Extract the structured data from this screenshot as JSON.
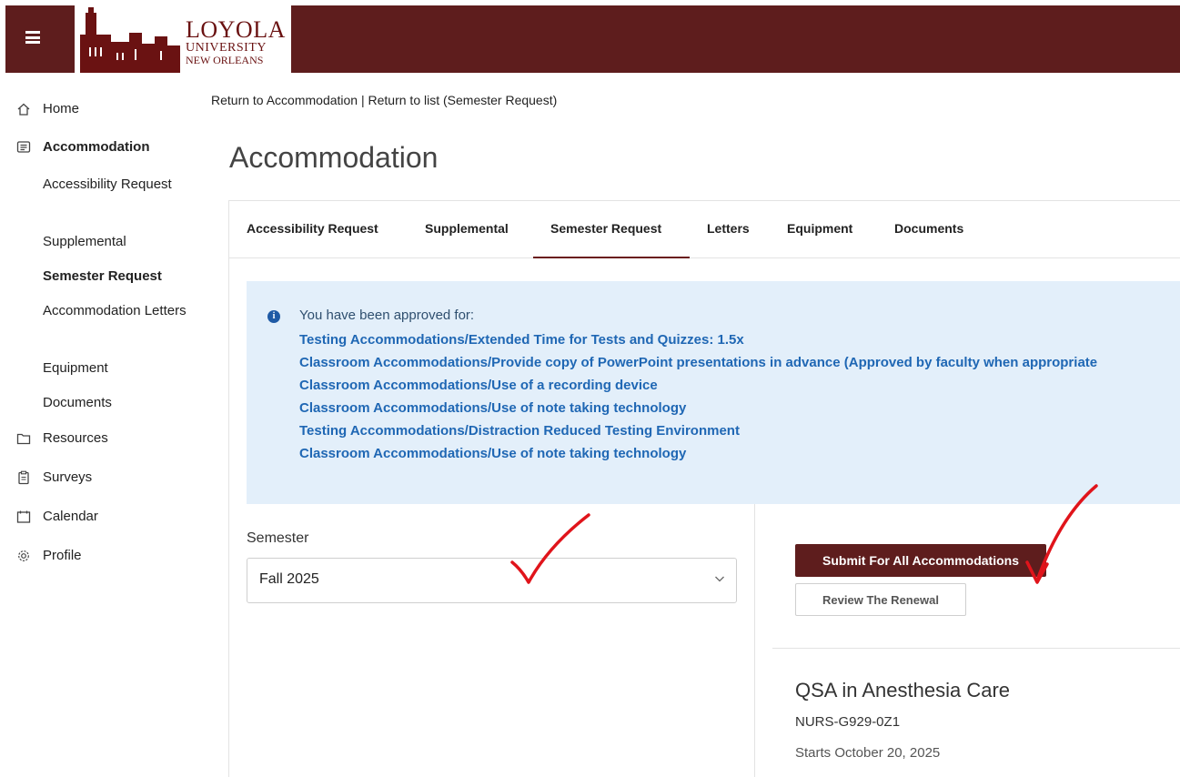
{
  "header": {
    "logo": {
      "line1": "LOYOLA",
      "line2": "UNIVERSITY",
      "line3": "NEW ORLEANS"
    },
    "colors": {
      "brand": "#5e1d1d",
      "link": "#1f67b4",
      "alert_bg": "#e3effa"
    }
  },
  "sidebar": {
    "items": [
      {
        "label": "Home",
        "icon": "home-icon"
      },
      {
        "label": "Accommodation",
        "icon": "chat-list-icon"
      },
      {
        "label": "Resources",
        "icon": "folder-icon"
      },
      {
        "label": "Surveys",
        "icon": "clipboard-icon"
      },
      {
        "label": "Calendar",
        "icon": "calendar-icon"
      },
      {
        "label": "Profile",
        "icon": "gear-icon"
      }
    ],
    "sub_items": [
      {
        "label": "Accessibility Request"
      },
      {
        "label": "Supplemental"
      },
      {
        "label": "Semester Request"
      },
      {
        "label": "Accommodation Letters"
      },
      {
        "label": "Equipment"
      },
      {
        "label": "Documents"
      }
    ]
  },
  "breadcrumb": {
    "link1": "Return to Accommodation",
    "separator": " | ",
    "link2": "Return to list (Semester Request)"
  },
  "page": {
    "title": "Accommodation"
  },
  "tabs": [
    {
      "label": "Accessibility Request"
    },
    {
      "label": "Supplemental"
    },
    {
      "label": "Semester Request"
    },
    {
      "label": "Letters"
    },
    {
      "label": "Equipment"
    },
    {
      "label": "Documents"
    }
  ],
  "alert": {
    "title": "You have been approved for:",
    "lines": [
      "Testing Accommodations/Extended Time for Tests and Quizzes: 1.5x",
      "Classroom Accommodations/Provide copy of PowerPoint presentations in advance (Approved by faculty when appropriate",
      "Classroom Accommodations/Use of a recording device",
      "Classroom Accommodations/Use of note taking technology",
      "Testing Accommodations/Distraction Reduced Testing Environment",
      "Classroom Accommodations/Use of note taking technology"
    ]
  },
  "semester": {
    "label": "Semester",
    "value": "Fall 2025"
  },
  "actions": {
    "submit_all": "Submit For All Accommodations",
    "review_renewal": "Review The Renewal"
  },
  "course": {
    "title": "QSA in Anesthesia Care",
    "code": "NURS-G929-0Z1",
    "start": "Starts October 20, 2025"
  }
}
